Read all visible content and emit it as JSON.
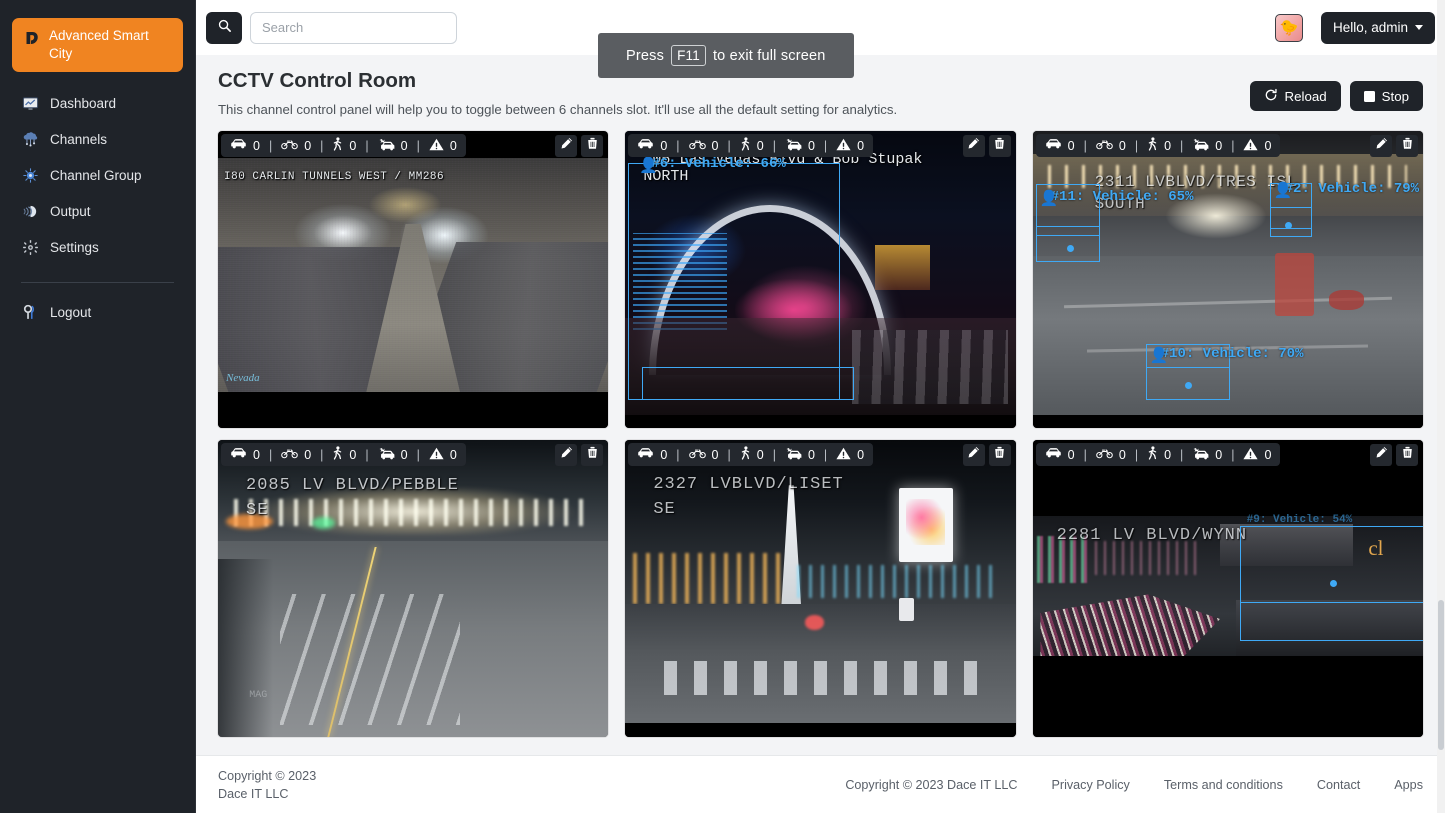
{
  "sidebar": {
    "brand": {
      "label": "Advanced Smart City",
      "icon": "smart-city-logo-icon",
      "accent": "#f08421"
    },
    "items": [
      {
        "label": "Dashboard",
        "icon": "dashboard-monitor-icon"
      },
      {
        "label": "Channels",
        "icon": "channels-cloud-icon"
      },
      {
        "label": "Channel Group",
        "icon": "channel-group-hub-icon"
      },
      {
        "label": "Output",
        "icon": "output-layers-icon"
      },
      {
        "label": "Settings",
        "icon": "gear-icon"
      }
    ],
    "logout": {
      "label": "Logout",
      "icon": "key-icon"
    }
  },
  "topbar": {
    "search": {
      "placeholder": "Search",
      "value": "",
      "icon": "search-icon"
    },
    "user": {
      "greeting": "Hello, admin",
      "avatar_icon": "user-avatar-duck"
    }
  },
  "fullscreen_toast": {
    "prefix": "Press",
    "key": "F11",
    "suffix": "to exit full screen"
  },
  "page": {
    "title": "CCTV Control Room",
    "subtitle": "This channel control panel will help you to toggle between 6 channels slot. It'll use all the default setting for analytics.",
    "actions": [
      {
        "label": "Reload",
        "icon": "reload-icon"
      },
      {
        "label": "Stop",
        "icon": "stop-square-icon"
      }
    ]
  },
  "counter_icons": [
    "car-icon",
    "motorcycle-icon",
    "pedestrian-icon",
    "car-crash-icon",
    "warning-triangle-icon"
  ],
  "panel_tools": [
    {
      "label": "Edit",
      "icon": "pencil-icon"
    },
    {
      "label": "Delete",
      "icon": "trash-icon"
    }
  ],
  "cameras": [
    {
      "id": "cam-1",
      "caption": "I80 CARLIN TUNNELS WEST / MM286",
      "counts": {
        "car": "0",
        "motorcycle": "0",
        "pedestrian": "0",
        "crash": "0",
        "warning": "0"
      },
      "detections": []
    },
    {
      "id": "cam-2",
      "caption": "106 Las Vegas Blvd & Bob Stupak\nNORTH",
      "counts": {
        "car": "0",
        "motorcycle": "0",
        "pedestrian": "0",
        "crash": "0",
        "warning": "0"
      },
      "detections": [
        {
          "label": "#6: Vehicle: 66%"
        }
      ]
    },
    {
      "id": "cam-3",
      "caption": "2311 LVBLVD/TRES ISL\nSOUTH",
      "counts": {
        "car": "0",
        "motorcycle": "0",
        "pedestrian": "0",
        "crash": "0",
        "warning": "0"
      },
      "detections": [
        {
          "label": "#11: Vehicle: 65%"
        },
        {
          "label": "#2: Vehicle: 79%"
        },
        {
          "label": "#10: Vehicle: 70%"
        }
      ]
    },
    {
      "id": "cam-4",
      "caption": "2085 LV BLVD/PEBBLE\nSE",
      "counts": {
        "car": "0",
        "motorcycle": "0",
        "pedestrian": "0",
        "crash": "0",
        "warning": "0"
      },
      "detections": []
    },
    {
      "id": "cam-5",
      "caption": "2327 LVBLVD/LISET\nSE",
      "counts": {
        "car": "0",
        "motorcycle": "0",
        "pedestrian": "0",
        "crash": "0",
        "warning": "0"
      },
      "detections": []
    },
    {
      "id": "cam-6",
      "caption": "2281 LV BLVD/WYNN",
      "counts": {
        "car": "0",
        "motorcycle": "0",
        "pedestrian": "0",
        "crash": "0",
        "warning": "0"
      },
      "detections": [
        {
          "label": "#9: Vehicle: 54%"
        }
      ]
    }
  ],
  "footer": {
    "copyright_line1": "Copyright © 2023",
    "copyright_line2": "Dace IT LLC",
    "links": [
      "Copyright © 2023 Dace IT LLC",
      "Privacy Policy",
      "Terms and conditions",
      "Contact",
      "Apps"
    ]
  }
}
